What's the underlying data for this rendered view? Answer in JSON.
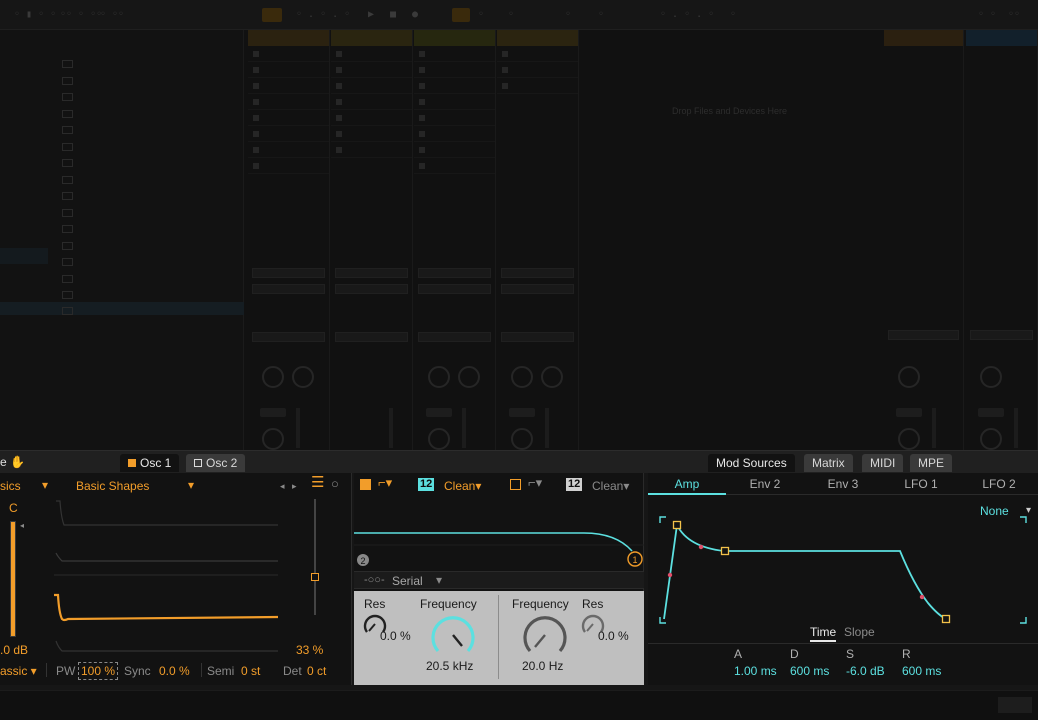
{
  "device": {
    "title": "e",
    "tabs": {
      "osc1": "Osc 1",
      "osc2": "Osc 2"
    },
    "right_tabs": [
      "Mod Sources",
      "Matrix",
      "MIDI",
      "MPE"
    ]
  },
  "osc": {
    "category": "sics",
    "wavetable": "Basic Shapes",
    "pitch_note": "C",
    "gain": ".0 dB",
    "position": "33 %",
    "position_fraction": 0.33,
    "mode": "assic",
    "pw_label": "PW",
    "pw_value": "100 %",
    "sync_label": "Sync",
    "sync_value": "0.0 %",
    "semi_label": "Semi",
    "semi_value": "0 st",
    "det_label": "Det",
    "det_value": "0 ct",
    "colors": {
      "accent": "#f29d2a"
    }
  },
  "filter": {
    "f1": {
      "slope": "12",
      "circuit": "Clean",
      "number": "1"
    },
    "f2": {
      "slope": "12",
      "circuit": "Clean",
      "number": "2"
    },
    "routing": "Serial",
    "res_label": "Res",
    "res_value": "0.0 %",
    "freq_label": "Frequency",
    "freq_value": "20.5 kHz",
    "f2_freq_label": "Frequency",
    "f2_res_label": "Res",
    "f2_freq_value": "20.0 Hz",
    "f2_res_value": "0.0 %",
    "colors": {
      "accent": "#5ce0e0",
      "panel": "#bfbfbf"
    }
  },
  "mod": {
    "tabs": [
      "Amp",
      "Env 2",
      "Env 3",
      "LFO 1",
      "LFO 2"
    ],
    "active_tab": "Amp",
    "target": "None",
    "view_time": "Time",
    "view_slope": "Slope",
    "adsr": [
      {
        "label": "A",
        "value": "1.00 ms"
      },
      {
        "label": "D",
        "value": "600 ms"
      },
      {
        "label": "S",
        "value": "-6.0 dB"
      },
      {
        "label": "R",
        "value": "600 ms"
      }
    ]
  },
  "session": {
    "drop_hint": "Drop Files and Devices Here"
  }
}
